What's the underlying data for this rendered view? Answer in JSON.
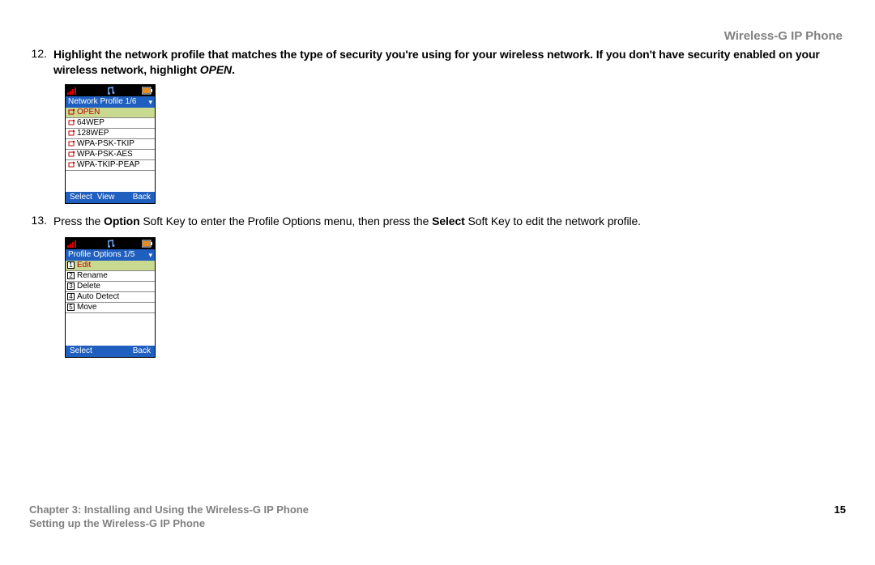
{
  "header": {
    "product": "Wireless-G IP Phone"
  },
  "steps": {
    "s12": {
      "num": "12.",
      "text_before": "Highlight the network profile that matches the type of security you're using for your wireless network. If you don't have security enabled on your wireless network, highlight ",
      "open_word": "OPEN",
      "text_after": "."
    },
    "s13": {
      "num": "13.",
      "p1": "Press the ",
      "b1": "Option",
      "p2": " Soft Key to enter the Profile Options menu, then press the ",
      "b2": "Select",
      "p3": " Soft Key to edit the network profile."
    }
  },
  "phone1": {
    "title": "Network Profile 1/6",
    "softkeys": {
      "left": "Select",
      "center": "View",
      "right": "Back"
    },
    "rows": [
      "OPEN",
      "64WEP",
      "128WEP",
      "WPA-PSK-TKIP",
      "WPA-PSK-AES",
      "WPA-TKIP-PEAP"
    ],
    "selected_index": 0
  },
  "phone2": {
    "title": "Profile Options 1/5",
    "softkeys": {
      "left": "Select",
      "right": "Back"
    },
    "rows": [
      "Edit",
      "Rename",
      "Delete",
      "Auto Detect",
      "Move"
    ],
    "selected_index": 0
  },
  "footer": {
    "chapter": "Chapter 3: Installing and Using the Wireless-G IP Phone",
    "section": "Setting up the Wireless-G IP Phone",
    "page_number": "15"
  }
}
